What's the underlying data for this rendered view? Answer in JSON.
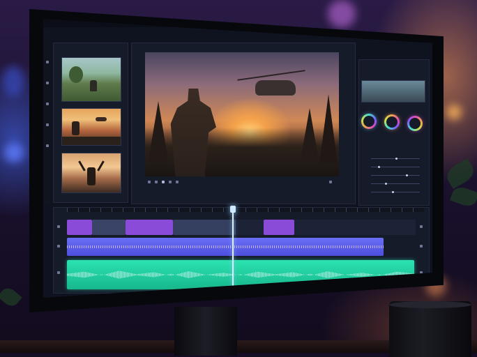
{
  "scene": {
    "title": "",
    "colors": {
      "accent_purple": "#8a4bd8",
      "audio_blue": "#5b5ff0",
      "audio_teal": "#2bd6a8",
      "playhead": "#8fd2ff",
      "wheel_teal": "#43e0d0",
      "wheel_orange": "#f2a34a",
      "wheel_pink": "#e04ac0"
    }
  },
  "editor": {
    "media_bin_title": "",
    "viewer_title": "",
    "inspector_title": "",
    "media_clips": [
      {
        "icon": "clip-thumbnail-soldier-field"
      },
      {
        "icon": "clip-thumbnail-soldier-helicopter"
      },
      {
        "icon": "clip-thumbnail-soldier-arms-raised"
      }
    ],
    "viewer_frame": {
      "icon": "soldier-helicopter-sunset-frame"
    },
    "color_wheels": [
      "wheel_teal",
      "wheel_orange",
      "wheel_pink"
    ],
    "timeline": {
      "tracks": [
        "video-track",
        "audio-track-1",
        "audio-track-2"
      ],
      "playhead_position": 0.49
    }
  }
}
